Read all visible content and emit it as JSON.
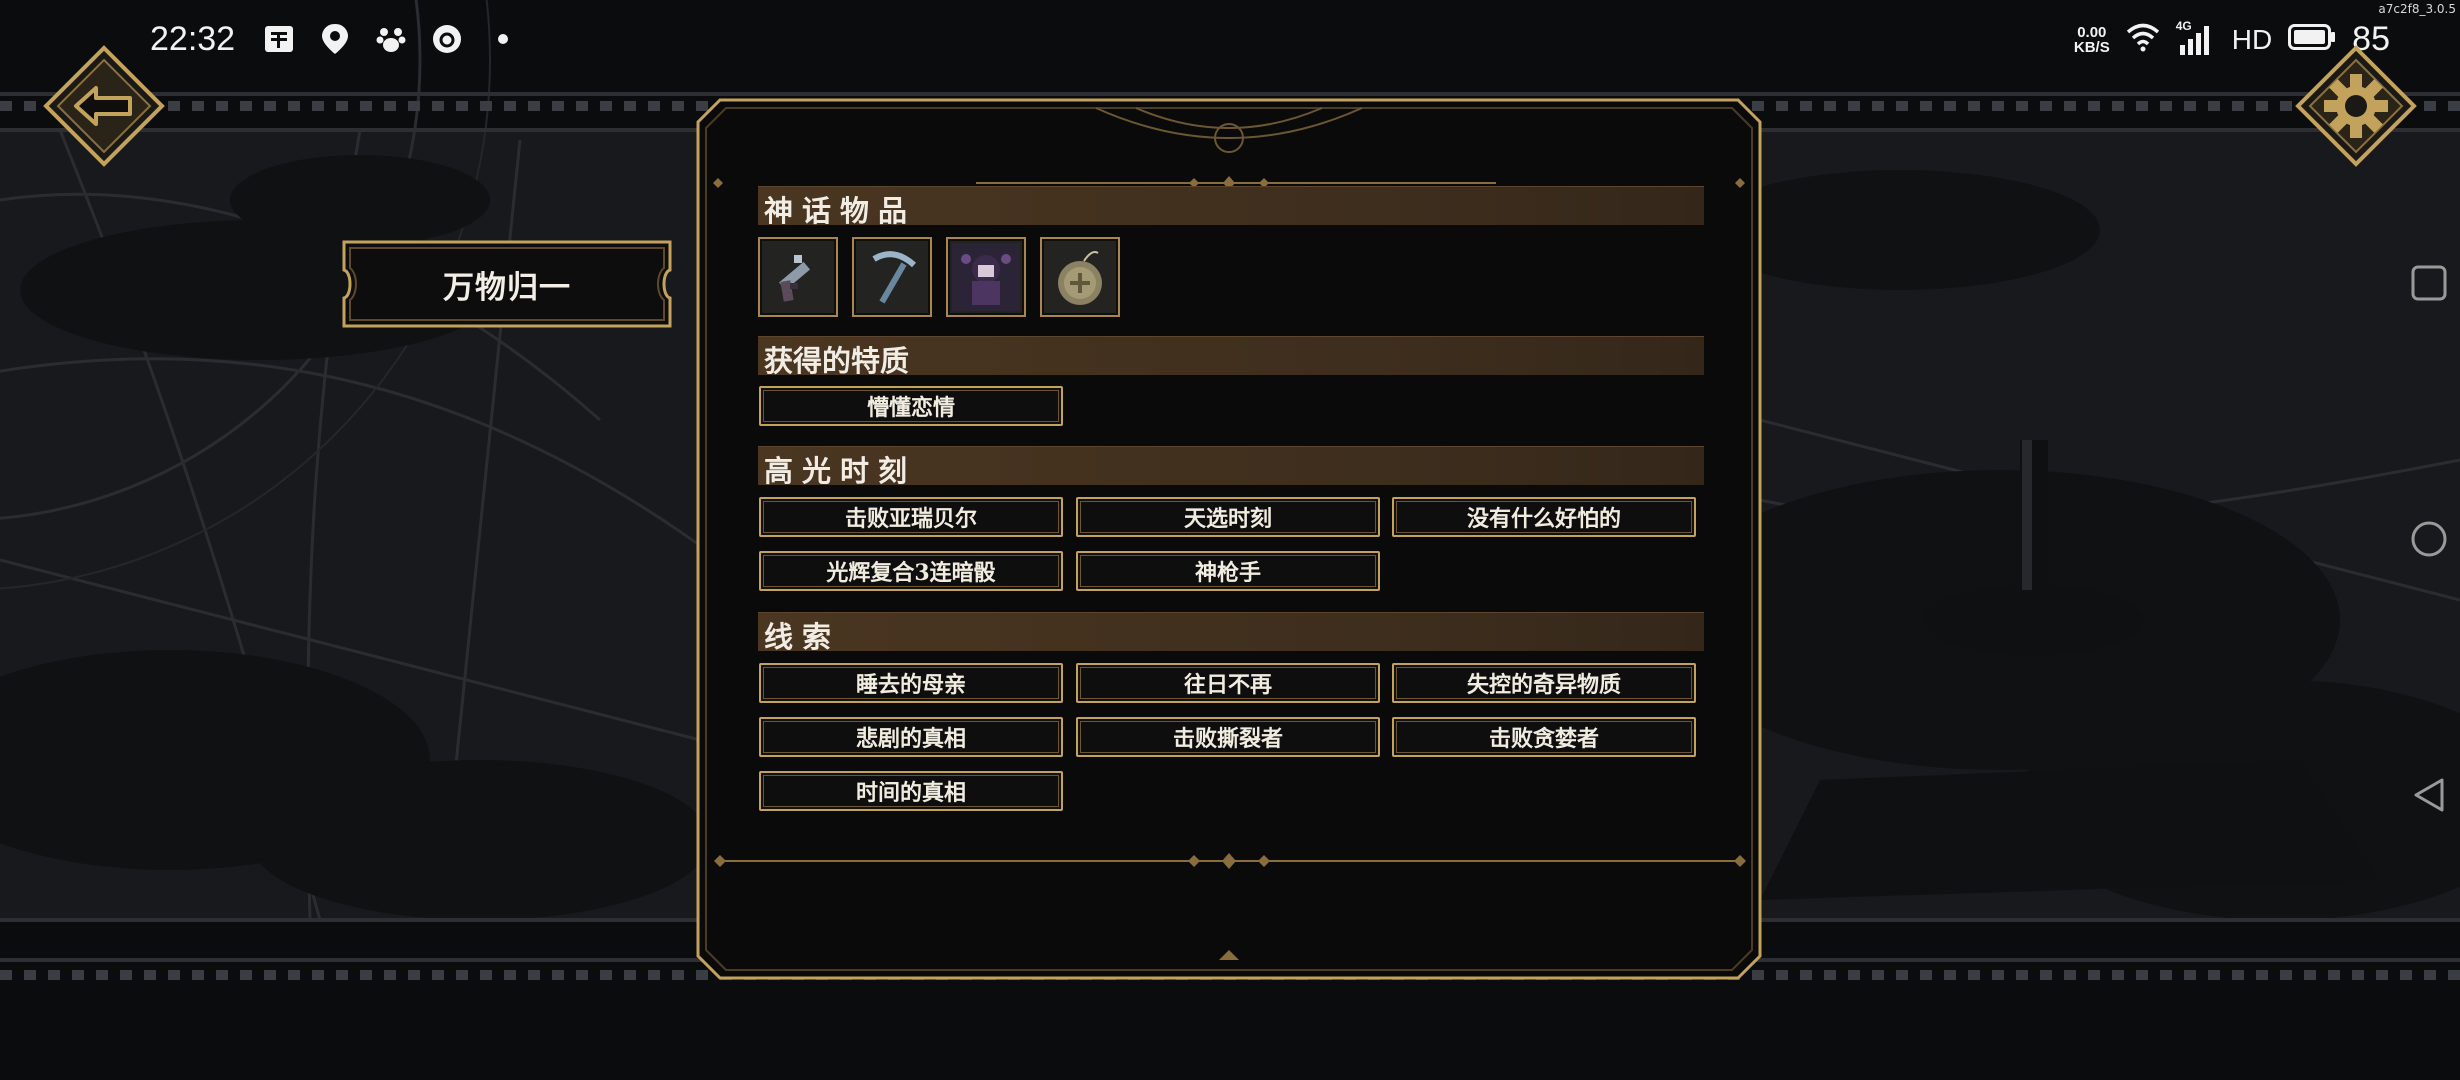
{
  "status_bar": {
    "time": "22:32",
    "net_speed_value": "0.00",
    "net_speed_unit": "KB/S",
    "network_type": "4G",
    "hd_label": "HD",
    "battery_level": "85",
    "left_icons": [
      "app-icon",
      "location-icon",
      "paw-icon",
      "circle-app-icon",
      "dot-icon"
    ],
    "right_icons": [
      "wifi-icon",
      "signal-icon",
      "battery-icon"
    ]
  },
  "version_label": "a7c2f8_3.0.5",
  "header": {
    "back_icon": "back-arrow-icon",
    "settings_icon": "gear-icon"
  },
  "title_plate": {
    "label": "万物归一"
  },
  "sections": {
    "mythic_items": {
      "title": "神话物品",
      "items": [
        {
          "name": "pistol-item-icon"
        },
        {
          "name": "pickaxe-item-icon"
        },
        {
          "name": "character-portrait-item-icon"
        },
        {
          "name": "bomb-item-icon"
        }
      ]
    },
    "traits": {
      "title": "获得的特质",
      "tags": [
        "懵懂恋情"
      ]
    },
    "highlights": {
      "title": "高光时刻",
      "tags": [
        "击败亚瑞贝尔",
        "天选时刻",
        "没有什么好怕的",
        "光辉复合3连暗骰",
        "神枪手"
      ]
    },
    "clues": {
      "title": "线索",
      "tags": [
        "睡去的母亲",
        "往日不再",
        "失控的奇异物质",
        "悲剧的真相",
        "击败撕裂者",
        "击败贪婪者",
        "时间的真相"
      ]
    }
  },
  "nav_bar": {
    "icons": [
      "recents-square-icon",
      "home-circle-icon",
      "back-triangle-icon"
    ]
  },
  "colors": {
    "gold_frame": "#c3a25c",
    "section_bar": "#4a3621",
    "background": "#0b0c0e"
  }
}
